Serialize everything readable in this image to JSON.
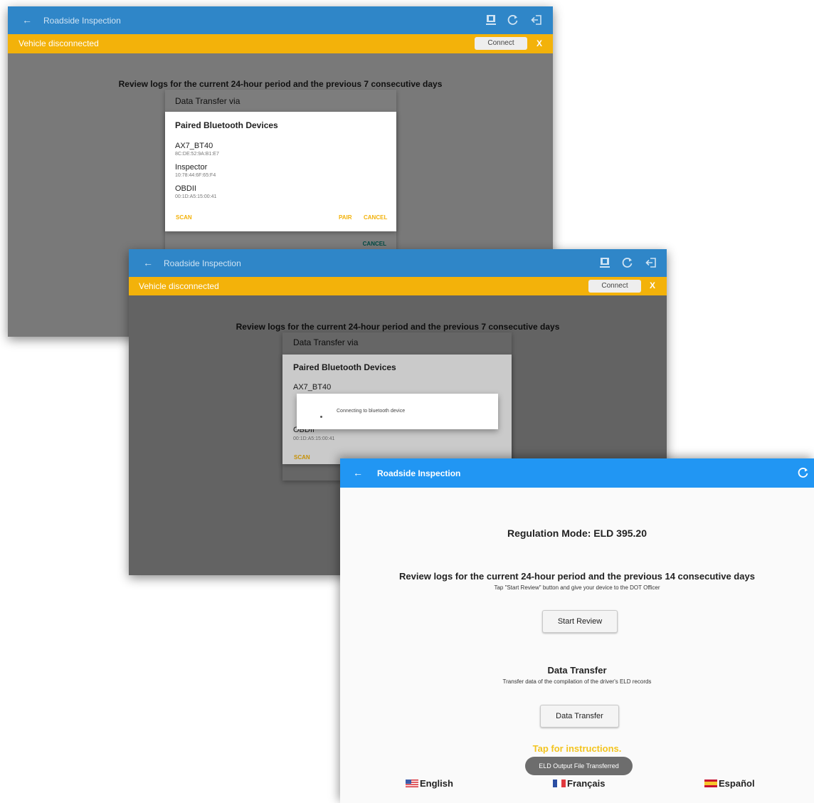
{
  "screen1": {
    "title": "Roadside Inspection",
    "banner_text": "Vehicle disconnected",
    "connect_label": "Connect",
    "close_label": "X",
    "review_text": "Review logs for the current 24-hour period and the previous 7 consecutive days",
    "transfer_dialog_title": "Data Transfer via",
    "transfer_cancel": "CANCEL",
    "paired_title": "Paired Bluetooth Devices",
    "devices": [
      {
        "name": "AX7_BT40",
        "mac": "8C:DE:52:9A:B1:E7"
      },
      {
        "name": "Inspector",
        "mac": "10:78:44:6F:65:F4"
      },
      {
        "name": "OBDII",
        "mac": "00:1D:A5:15:00:41"
      }
    ],
    "scan_label": "SCAN",
    "pair_label": "PAIR",
    "cancel_label": "CANCEL"
  },
  "screen2": {
    "title": "Roadside Inspection",
    "banner_text": "Vehicle disconnected",
    "connect_label": "Connect",
    "close_label": "X",
    "review_text": "Review logs for the current 24-hour period and the previous 7 consecutive days",
    "transfer_dialog_title": "Data Transfer via",
    "paired_title": "Paired Bluetooth Devices",
    "device1_name": "AX7_BT40",
    "device3_name": "OBDII",
    "device3_mac": "00:1D:A5:15:00:41",
    "scan_label": "SCAN",
    "connecting_text": "Connecting to bluetooth device"
  },
  "screen3": {
    "title": "Roadside Inspection",
    "regulation_mode": "Regulation Mode: ELD 395.20",
    "review_heading": "Review logs for the current 24-hour period and the previous 14 consecutive days",
    "review_sub": "Tap \"Start Review\" button and give your device to the DOT Officer",
    "start_review_label": "Start Review",
    "data_transfer_heading": "Data Transfer",
    "data_transfer_sub": "Transfer data of the compilation of the driver's ELD records",
    "data_transfer_label": "Data Transfer",
    "instructions_link": "Tap for instructions.",
    "toast": "ELD Output File Transferred",
    "languages": [
      "English",
      "Français",
      "Español"
    ]
  },
  "colors": {
    "appbar_dark": "#2f86c8",
    "appbar_light": "#2196f3",
    "banner": "#f3b20a",
    "accent": "#f3b20a"
  },
  "icons": [
    "back-arrow-icon",
    "eld-device-icon",
    "refresh-icon",
    "logout-icon",
    "spinner-icon",
    "us-flag-icon",
    "france-flag-icon",
    "spain-flag-icon"
  ]
}
